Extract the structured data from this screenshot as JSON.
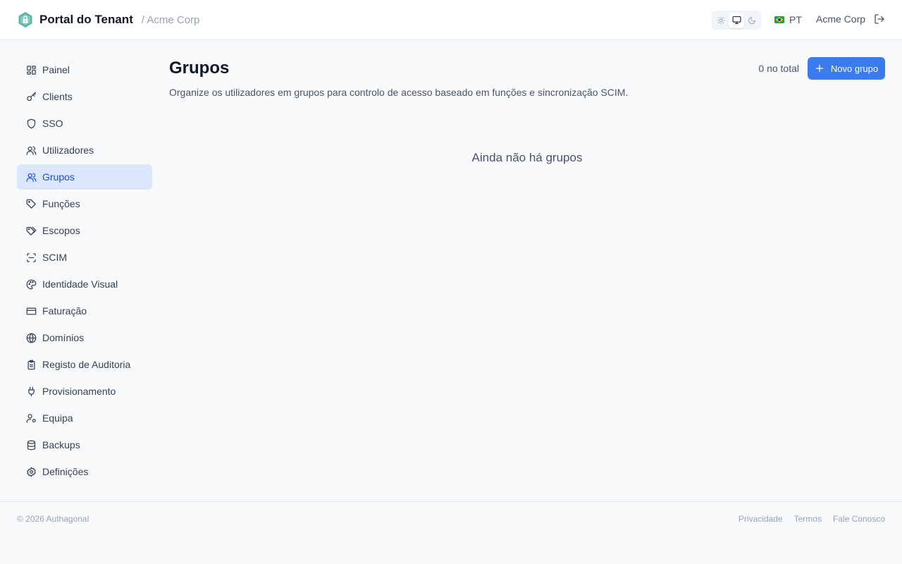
{
  "header": {
    "title": "Portal do Tenant",
    "tenant_crumb": "/ Acme Corp",
    "theme_options": [
      "light-icon",
      "system-icon",
      "dark-icon"
    ],
    "theme_selected": "system",
    "language": "PT",
    "account": "Acme Corp"
  },
  "sidebar": {
    "items": [
      {
        "label": "Painel",
        "icon": "dashboard-icon"
      },
      {
        "label": "Clients",
        "icon": "key-icon"
      },
      {
        "label": "SSO",
        "icon": "shield-icon"
      },
      {
        "label": "Utilizadores",
        "icon": "users-icon"
      },
      {
        "label": "Grupos",
        "icon": "users-icon",
        "active": true
      },
      {
        "label": "Funções",
        "icon": "tag-icon"
      },
      {
        "label": "Escopos",
        "icon": "tags-icon"
      },
      {
        "label": "SCIM",
        "icon": "scan-icon"
      },
      {
        "label": "Identidade Visual",
        "icon": "palette-icon"
      },
      {
        "label": "Faturação",
        "icon": "credit-card-icon"
      },
      {
        "label": "Domínios",
        "icon": "globe-icon"
      },
      {
        "label": "Registo de Auditoria",
        "icon": "clipboard-icon"
      },
      {
        "label": "Provisionamento",
        "icon": "plug-icon"
      },
      {
        "label": "Equipa",
        "icon": "user-cog-icon"
      },
      {
        "label": "Backups",
        "icon": "database-icon"
      },
      {
        "label": "Definições",
        "icon": "gear-icon"
      }
    ]
  },
  "main": {
    "title": "Grupos",
    "description": "Organize os utilizadores em grupos para controlo de acesso baseado em funções e sincronização SCIM.",
    "count": "0 no total",
    "new_button": "Novo grupo",
    "empty": "Ainda não há grupos"
  },
  "footer": {
    "copyright": "© 2026 Authagonal",
    "links": [
      "Privacidade",
      "Termos",
      "Fale Conosco"
    ]
  },
  "colors": {
    "accent": "#3b7ced",
    "active_bg": "#dbe6fb",
    "active_text": "#1d4ed8",
    "brand": "#5bb5a8"
  }
}
